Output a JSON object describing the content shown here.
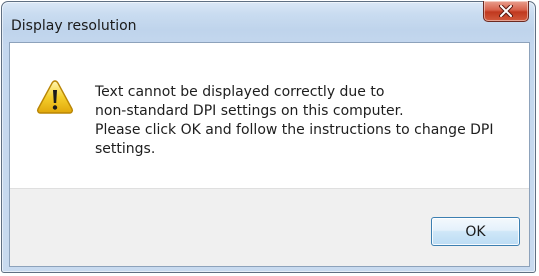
{
  "window": {
    "title": "Display resolution",
    "close_icon": "close-x-icon"
  },
  "dialog": {
    "icon": "warning-icon",
    "message_lines": [
      "Text cannot be displayed correctly due to",
      "non-standard DPI settings on this computer.",
      "Please click OK and follow the instructions to change DPI",
      "settings."
    ]
  },
  "buttons": {
    "ok_label": "OK"
  },
  "colors": {
    "frame": "#c4d7ee",
    "close_button": "#c8452c",
    "warning_fill": "#f2c21a",
    "button_border": "#3c7fb1"
  }
}
